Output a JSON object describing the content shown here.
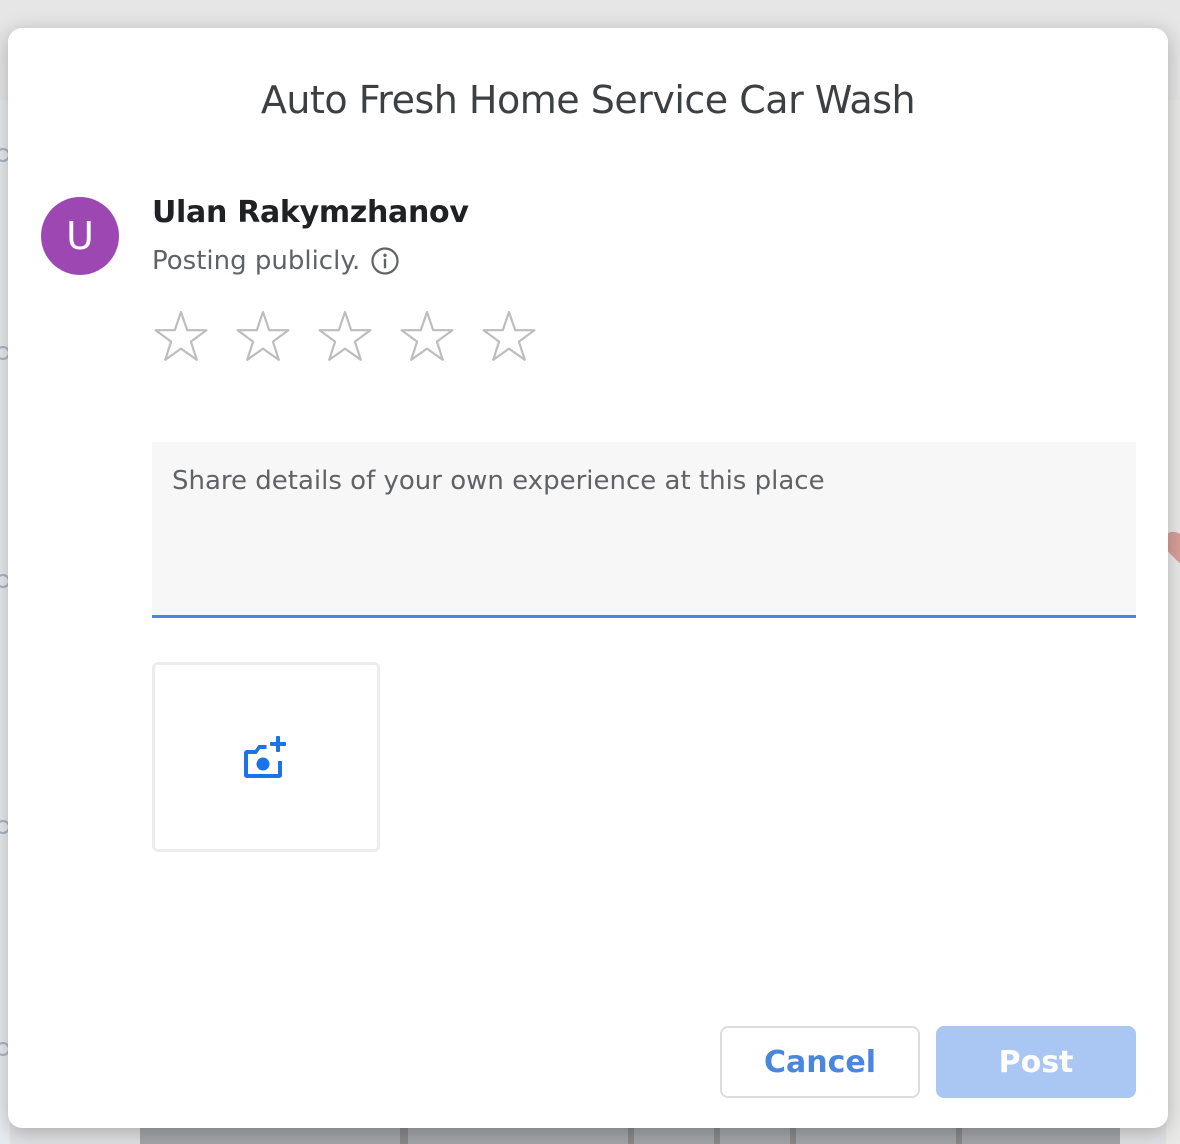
{
  "dialog": {
    "title": "Auto Fresh Home Service Car Wash"
  },
  "user": {
    "avatar_initial": "U",
    "avatar_color": "#9d48b2",
    "name": "Ulan Rakymzhanov",
    "posting_status": "Posting publicly.",
    "info_icon": "info-icon"
  },
  "rating": {
    "max_stars": 5,
    "selected": 0,
    "star_icon": "star-outline-icon"
  },
  "review": {
    "placeholder": "Share details of your own experience at this place",
    "value": ""
  },
  "photo": {
    "icon": "add-photo-camera-icon"
  },
  "actions": {
    "cancel_label": "Cancel",
    "post_label": "Post",
    "post_enabled": false
  },
  "colors": {
    "accent": "#4a86e0",
    "post_disabled_bg": "#a9c7f2",
    "text_primary": "#202124",
    "text_secondary": "#5f6368"
  }
}
